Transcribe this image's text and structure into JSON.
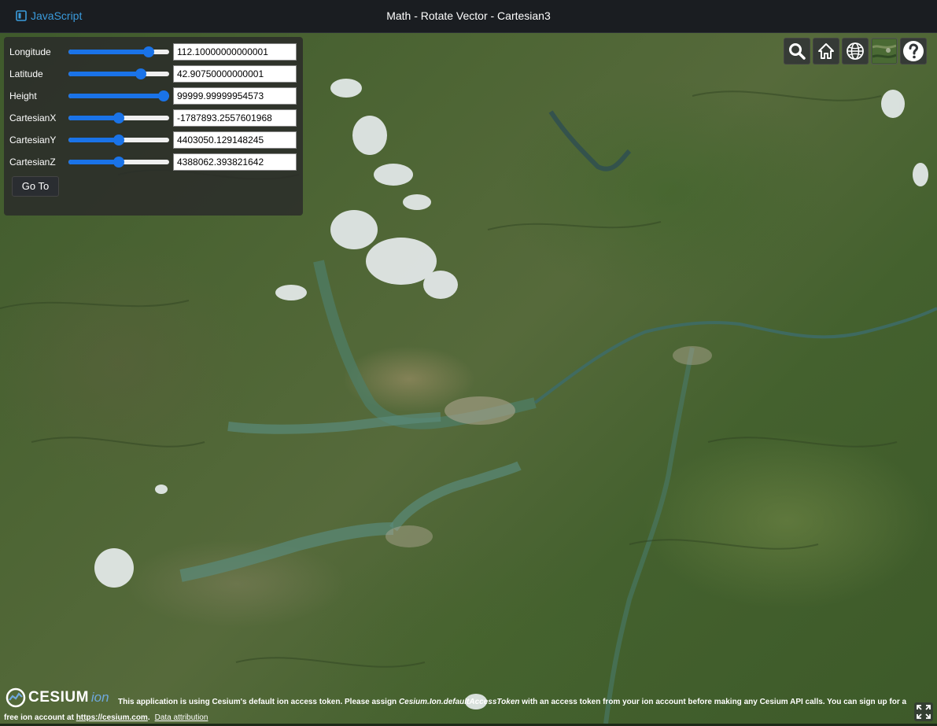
{
  "header": {
    "language": "JavaScript",
    "title": "Math - Rotate Vector - Cartesian3"
  },
  "panel": {
    "rows": [
      {
        "label": "Longitude",
        "value": "112.10000000000001",
        "slider_fraction": 0.8
      },
      {
        "label": "Latitude",
        "value": "42.90750000000001",
        "slider_fraction": 0.72
      },
      {
        "label": "Height",
        "value": "99999.99999954573",
        "slider_fraction": 1.0
      },
      {
        "label": "CartesianX",
        "value": "-1787893.2557601968",
        "slider_fraction": 0.5
      },
      {
        "label": "CartesianY",
        "value": "4403050.129148245",
        "slider_fraction": 0.5
      },
      {
        "label": "CartesianZ",
        "value": "4388062.393821642",
        "slider_fraction": 0.5
      }
    ],
    "go_label": "Go To"
  },
  "toolbar": {
    "buttons": [
      "search-icon",
      "home-icon",
      "globe-icon",
      "imagery-picker-icon",
      "help-icon"
    ]
  },
  "credits": {
    "logo_text": "CESIUM",
    "logo_ion": "ion",
    "text_before": "This application is using Cesium's default ion access token. Please assign ",
    "token_name": "Cesium.Ion.defaultAccessToken",
    "text_after": " with an access token from your ion account before making any Cesium API calls. You can sign up for a free ion account at ",
    "link": "https://cesium.com",
    "period": ".",
    "attribution": "Data attribution"
  },
  "colors": {
    "accent": "#1a73e8",
    "header_bg": "#1a1d21",
    "link": "#3a9bdc"
  }
}
